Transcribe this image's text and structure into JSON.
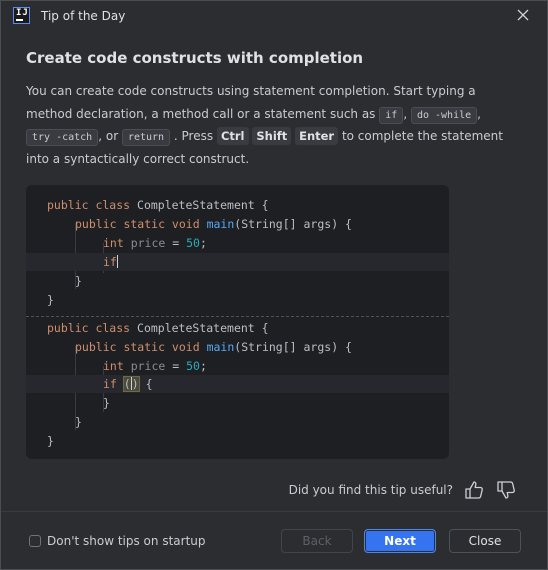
{
  "window": {
    "title": "Tip of the Day",
    "app_icon_text": "IJ"
  },
  "tip": {
    "title": "Create code constructs with completion",
    "body_part1": "You can create code constructs using statement completion. Start typing a method declaration, a method call or a statement such as",
    "token_if": "if",
    "token_do_while": "do -while",
    "token_try_catch": "try -catch",
    "or_word": ", or",
    "token_return": "return",
    "press_word": ". Press",
    "key_ctrl": "Ctrl",
    "key_shift": "Shift",
    "key_enter": "Enter",
    "body_part2": "to complete the statement into a syntactically correct construct."
  },
  "code_before": {
    "line1_kw": "public class ",
    "line1_name": "CompleteStatement {",
    "line2_kw": "public static void ",
    "line2_fn": "main",
    "line2_rest": "(String[] args) {",
    "line3_kw": "int ",
    "line3_var": "price",
    "line3_eq": " = ",
    "line3_num": "50",
    "line3_end": ";",
    "line4_kw": "if",
    "line5": "}",
    "line6": "}"
  },
  "code_after": {
    "line1_kw": "public class ",
    "line1_name": "CompleteStatement {",
    "line2_kw": "public static void ",
    "line2_fn": "main",
    "line2_rest": "(String[] args) {",
    "line3_kw": "int ",
    "line3_var": "price",
    "line3_eq": " = ",
    "line3_num": "50",
    "line3_end": ";",
    "line4_kw": "if",
    "line4_paren_open": "(",
    "line4_paren_close": ")",
    "line4_brace": " {",
    "line5": "}",
    "line6": "}",
    "line7": "}"
  },
  "feedback": {
    "question": "Did you find this tip useful?"
  },
  "footer": {
    "checkbox_label": "Don't show tips on startup",
    "checkbox_checked": false,
    "back_label": "Back",
    "next_label": "Next",
    "close_label": "Close"
  },
  "colors": {
    "background": "#2b2d30",
    "code_background": "#1e1f22",
    "keyword": "#cf8e6d",
    "function": "#56a8f5",
    "number": "#2aacb8",
    "accent_button": "#3574f0"
  }
}
